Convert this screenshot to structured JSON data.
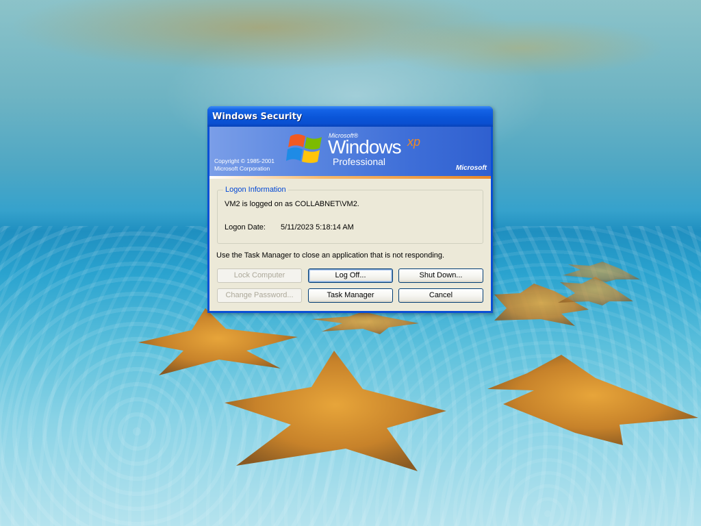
{
  "dialog": {
    "title": "Windows Security",
    "banner": {
      "copyright_line1": "Copyright © 1985-2001",
      "copyright_line2": "Microsoft Corporation",
      "brand_microsoft_small": "Microsoft®",
      "brand_windows": "Windows",
      "brand_xp": "xp",
      "brand_edition": "Professional",
      "brand_microsoft_right": "Microsoft"
    },
    "logon_info": {
      "legend": "Logon Information",
      "logged_on_text": "VM2 is logged on as COLLABNET\\VM2.",
      "logon_date_label": "Logon Date:",
      "logon_date_value": "5/11/2023 5:18:14 AM"
    },
    "hint": "Use the Task Manager to close an application that is not responding.",
    "buttons": {
      "lock_computer": "Lock Computer",
      "log_off": "Log Off...",
      "shut_down": "Shut Down...",
      "change_password": "Change Password...",
      "task_manager": "Task Manager",
      "cancel": "Cancel"
    }
  },
  "colors": {
    "title_bar": "#0a55d8",
    "client_bg": "#ece9d8",
    "legend_text": "#0046d5",
    "xp_orange": "#f08a24"
  }
}
